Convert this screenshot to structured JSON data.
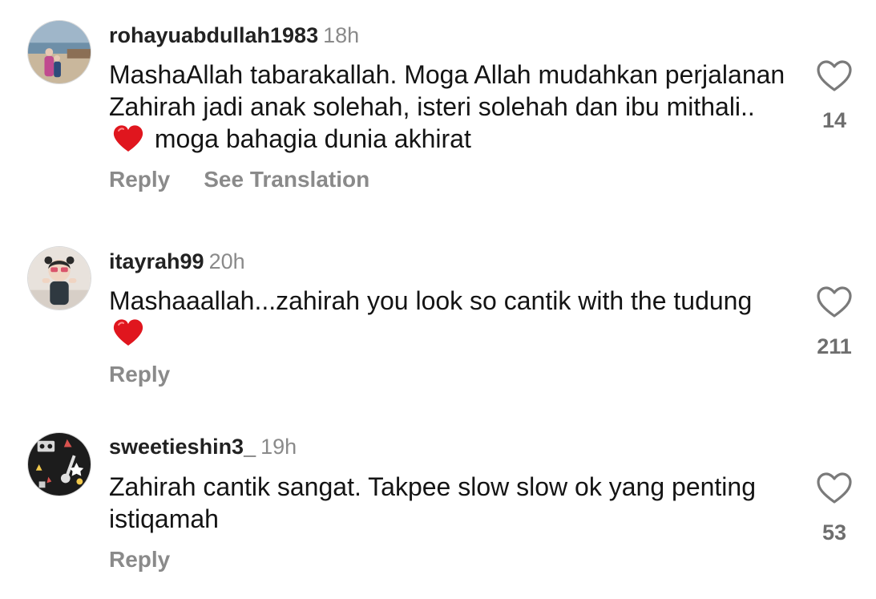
{
  "comments": [
    {
      "username": "rohayuabdullah1983",
      "time": "18h",
      "text_parts": [
        "MashaAllah tabarakallah.  Moga Allah mudahkan perjalanan Zahirah jadi anak solehah, isteri solehah dan ibu mithali.. ",
        " moga bahagia dunia akhirat"
      ],
      "emoji": "red-heart",
      "reply_label": "Reply",
      "translation_label": "See Translation",
      "likes": "14"
    },
    {
      "username": "itayrah99",
      "time": "20h",
      "text_parts": [
        "Mashaaallah...zahirah you look so cantik with the tudung ",
        ""
      ],
      "emoji": "red-heart",
      "reply_label": "Reply",
      "likes": "211"
    },
    {
      "username": "sweetieshin3_",
      "time": "19h",
      "text_parts": [
        "Zahirah cantik sangat. Takpee slow slow ok yang penting istiqamah"
      ],
      "reply_label": "Reply",
      "likes": "53"
    }
  ],
  "icons": {
    "like": "heart-outline-icon",
    "emoji": "red-heart-emoji"
  },
  "colors": {
    "username": "#222222",
    "muted": "#8a8a8a",
    "heart_emoji": "#e0161e"
  }
}
